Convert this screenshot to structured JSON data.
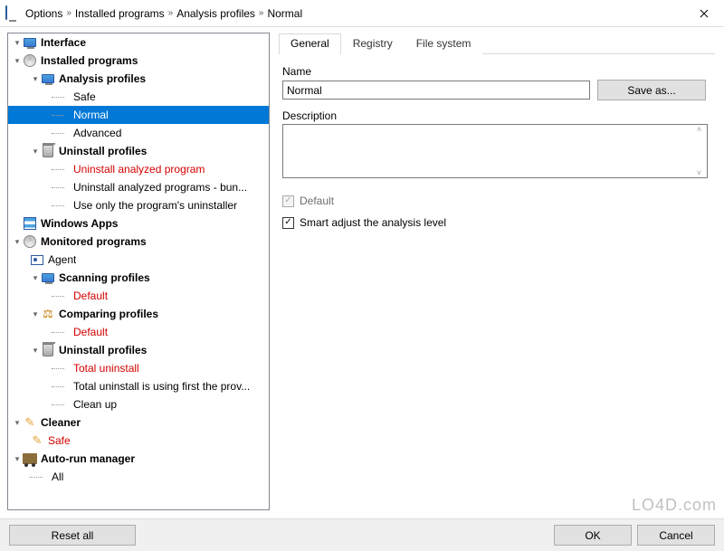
{
  "titlebar": {
    "breadcrumbs": [
      "Options",
      "Installed programs",
      "Analysis profiles",
      "Normal"
    ]
  },
  "tree": [
    {
      "depth": 0,
      "label": "Interface",
      "bold": true,
      "icon": "monitor",
      "expander": "▾"
    },
    {
      "depth": 0,
      "label": "Installed programs",
      "bold": true,
      "icon": "disk",
      "expander": "▾"
    },
    {
      "depth": 1,
      "label": "Analysis profiles",
      "bold": true,
      "icon": "monitor",
      "expander": "▾"
    },
    {
      "depth": 2,
      "label": "Safe",
      "connector": true
    },
    {
      "depth": 2,
      "label": "Normal",
      "selected": true,
      "connector": true
    },
    {
      "depth": 2,
      "label": "Advanced",
      "connector": true
    },
    {
      "depth": 1,
      "label": "Uninstall profiles",
      "bold": true,
      "icon": "trash",
      "expander": "▾"
    },
    {
      "depth": 2,
      "label": "Uninstall analyzed program",
      "red": true,
      "connector": true
    },
    {
      "depth": 2,
      "label": "Uninstall analyzed programs - bun...",
      "connector": true
    },
    {
      "depth": 2,
      "label": "Use only the program's uninstaller",
      "connector": true
    },
    {
      "depth": 0,
      "label": "Windows Apps",
      "bold": true,
      "icon": "grid"
    },
    {
      "depth": 0,
      "label": "Monitored programs",
      "bold": true,
      "icon": "disk",
      "expander": "▾"
    },
    {
      "depth": 1,
      "label": "Agent",
      "icon": "agent",
      "connector": false
    },
    {
      "depth": 1,
      "label": "Scanning profiles",
      "bold": true,
      "icon": "monitor",
      "expander": "▾"
    },
    {
      "depth": 2,
      "label": "Default",
      "red": true,
      "connector": true
    },
    {
      "depth": 1,
      "label": "Comparing profiles",
      "bold": true,
      "icon": "scales",
      "expander": "▾"
    },
    {
      "depth": 2,
      "label": "Default",
      "red": true,
      "connector": true
    },
    {
      "depth": 1,
      "label": "Uninstall profiles",
      "bold": true,
      "icon": "trash",
      "expander": "▾"
    },
    {
      "depth": 2,
      "label": "Total uninstall",
      "red": true,
      "connector": true
    },
    {
      "depth": 2,
      "label": "Total uninstall is using first the prov...",
      "connector": true
    },
    {
      "depth": 2,
      "label": "Clean up",
      "connector": true
    },
    {
      "depth": 0,
      "label": "Cleaner",
      "bold": true,
      "icon": "brush",
      "expander": "▾"
    },
    {
      "depth": 1,
      "label": "Safe",
      "red": true,
      "icon": "brush",
      "connector": false
    },
    {
      "depth": 0,
      "label": "Auto-run manager",
      "bold": true,
      "icon": "truck",
      "expander": "▾"
    },
    {
      "depth": 1,
      "label": "All",
      "connector": true
    }
  ],
  "tabs": [
    "General",
    "Registry",
    "File system"
  ],
  "form": {
    "name_label": "Name",
    "name_value": "Normal",
    "save_as": "Save as...",
    "desc_label": "Description",
    "desc_value": "",
    "default_label": "Default",
    "smart_label": "Smart adjust the analysis level"
  },
  "buttons": {
    "reset": "Reset all",
    "ok": "OK",
    "cancel": "Cancel"
  },
  "watermark": "LO4D.com"
}
